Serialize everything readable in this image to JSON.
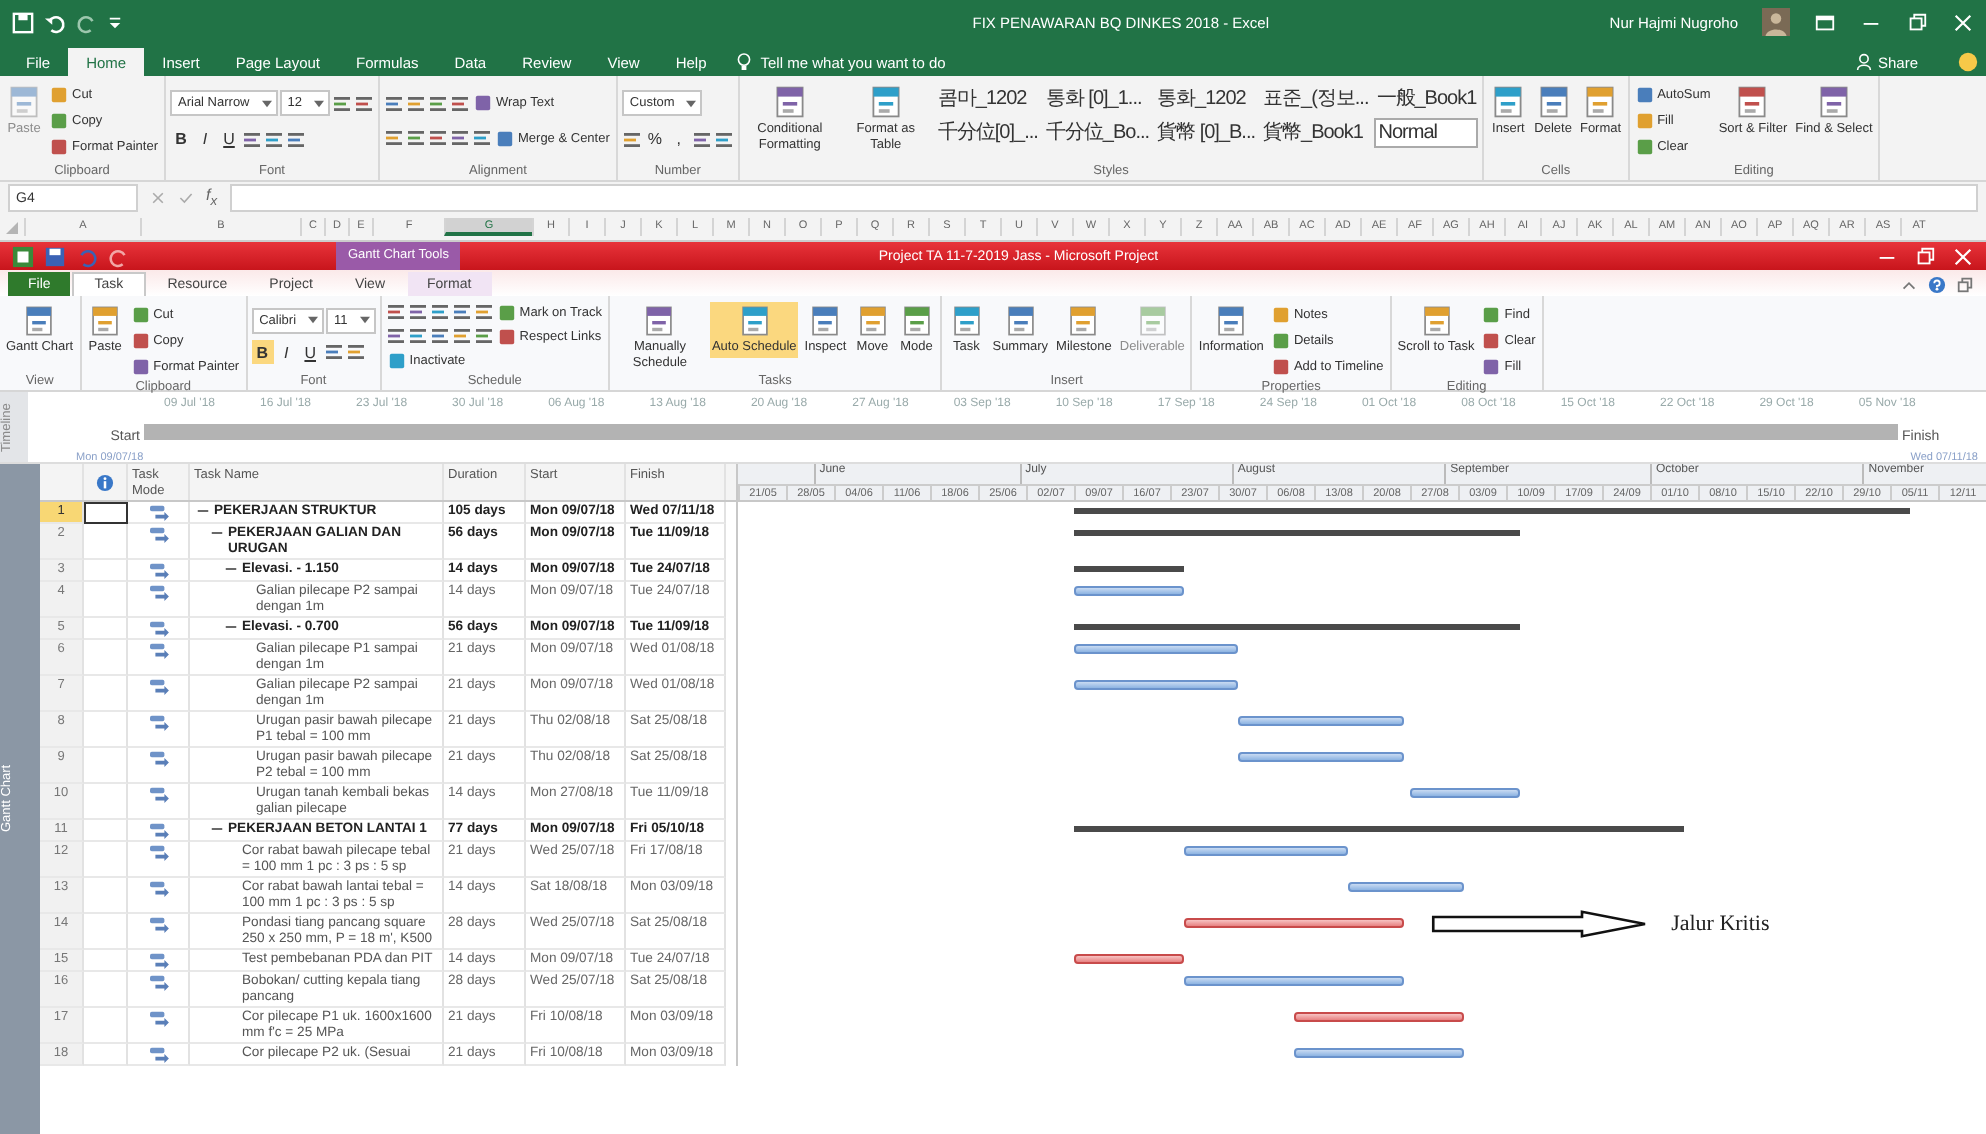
{
  "excel": {
    "title": "FIX PENAWARAN BQ DINKES 2018  -  Excel",
    "user": "Nur Hajmi Nugroho",
    "tabs": [
      {
        "label": "File",
        "selected": false
      },
      {
        "label": "Home",
        "selected": true
      },
      {
        "label": "Insert",
        "selected": false
      },
      {
        "label": "Page Layout",
        "selected": false
      },
      {
        "label": "Formulas",
        "selected": false
      },
      {
        "label": "Data",
        "selected": false
      },
      {
        "label": "Review",
        "selected": false
      },
      {
        "label": "View",
        "selected": false
      },
      {
        "label": "Help",
        "selected": false
      }
    ],
    "tell_me": "Tell me what you want to do",
    "share": "Share",
    "ribbon": [
      {
        "label": "Clipboard",
        "items": [
          {
            "label": "Paste",
            "kind": "large",
            "disabled": true
          },
          {
            "label": "Cut",
            "kind": "small",
            "disabled": false
          },
          {
            "label": "Copy",
            "kind": "small",
            "disabled": false
          },
          {
            "label": "Format Painter",
            "kind": "small",
            "disabled": false
          }
        ]
      },
      {
        "label": "Font",
        "lines": [
          [
            {
              "label": "Arial Narrow",
              "kind": "combo"
            },
            {
              "label": "12",
              "kind": "combo"
            },
            {
              "kind": "icon"
            },
            {
              "kind": "icon"
            }
          ],
          [
            {
              "label": "B",
              "kind": "bold",
              "selected": false
            },
            {
              "label": "I",
              "kind": "italic",
              "selected": false
            },
            {
              "label": "U",
              "kind": "underline",
              "selected": false
            },
            {
              "kind": "icon"
            },
            {
              "kind": "icon"
            },
            {
              "kind": "icon"
            }
          ]
        ]
      },
      {
        "label": "Alignment",
        "lines": [
          [
            {
              "kind": "icon"
            },
            {
              "kind": "icon"
            },
            {
              "kind": "icon"
            },
            {
              "kind": "icon"
            },
            {
              "label": "Wrap Text",
              "kind": "small"
            }
          ],
          [
            {
              "kind": "icon"
            },
            {
              "kind": "icon"
            },
            {
              "kind": "icon"
            },
            {
              "kind": "icon"
            },
            {
              "kind": "icon"
            },
            {
              "label": "Merge & Center",
              "kind": "small"
            }
          ]
        ]
      },
      {
        "label": "Number",
        "lines": [
          [
            {
              "label": "Custom",
              "kind": "combo"
            }
          ],
          [
            {
              "kind": "icon"
            },
            {
              "label": "%",
              "kind": "glyph"
            },
            {
              "label": ",",
              "kind": "glyph"
            },
            {
              "kind": "icon"
            },
            {
              "kind": "icon"
            }
          ]
        ]
      },
      {
        "label": "Styles",
        "items": [
          {
            "label": "Conditional Formatting",
            "kind": "large"
          },
          {
            "label": "Format as Table",
            "kind": "large"
          }
        ],
        "gallery": [
          "콤마_1202",
          "통화 [0]_1...",
          "통화_1202",
          "표준_(정보...",
          "一般_Book1",
          "千分位[0]_...",
          "千分位_Bo...",
          "貨幣 [0]_B...",
          "貨幣_Book1",
          "Normal"
        ]
      },
      {
        "label": "Cells",
        "items": [
          {
            "label": "Insert",
            "kind": "large"
          },
          {
            "label": "Delete",
            "kind": "large"
          },
          {
            "label": "Format",
            "kind": "large"
          }
        ]
      },
      {
        "label": "Editing",
        "items": [
          {
            "label": "AutoSum",
            "kind": "small"
          },
          {
            "label": "Fill",
            "kind": "small"
          },
          {
            "label": "Clear",
            "kind": "small"
          },
          {
            "label": "Sort & Filter",
            "kind": "large"
          },
          {
            "label": "Find & Select",
            "kind": "large"
          }
        ]
      }
    ],
    "name_box": "G4",
    "function_label": "f$_{x}$",
    "columns": [
      {
        "label": "A",
        "selected": false
      },
      {
        "label": "B",
        "selected": false
      },
      {
        "label": "C",
        "selected": false
      },
      {
        "label": "D",
        "selected": false
      },
      {
        "label": "E",
        "selected": false
      },
      {
        "label": "F",
        "selected": false
      },
      {
        "label": "G",
        "selected": true
      },
      {
        "label": "H",
        "selected": false
      },
      {
        "label": "I",
        "selected": false
      },
      {
        "label": "J",
        "selected": false
      },
      {
        "label": "K",
        "selected": false
      },
      {
        "label": "L",
        "selected": false
      },
      {
        "label": "M",
        "selected": false
      },
      {
        "label": "N",
        "selected": false
      },
      {
        "label": "O",
        "selected": false
      },
      {
        "label": "P",
        "selected": false
      },
      {
        "label": "Q",
        "selected": false
      },
      {
        "label": "R",
        "selected": false
      },
      {
        "label": "S",
        "selected": false
      },
      {
        "label": "T",
        "selected": false
      },
      {
        "label": "U",
        "selected": false
      },
      {
        "label": "V",
        "selected": false
      },
      {
        "label": "W",
        "selected": false
      },
      {
        "label": "X",
        "selected": false
      },
      {
        "label": "Y",
        "selected": false
      },
      {
        "label": "Z",
        "selected": false
      },
      {
        "label": "AA",
        "selected": false
      },
      {
        "label": "AB",
        "selected": false
      },
      {
        "label": "AC",
        "selected": false
      },
      {
        "label": "AD",
        "selected": false
      },
      {
        "label": "AE",
        "selected": false
      },
      {
        "label": "AF",
        "selected": false
      },
      {
        "label": "AG",
        "selected": false
      },
      {
        "label": "AH",
        "selected": false
      },
      {
        "label": "AI",
        "selected": false
      },
      {
        "label": "AJ",
        "selected": false
      },
      {
        "label": "AK",
        "selected": false
      },
      {
        "label": "AL",
        "selected": false
      },
      {
        "label": "AM",
        "selected": false
      },
      {
        "label": "AN",
        "selected": false
      },
      {
        "label": "AO",
        "selected": false
      },
      {
        "label": "AP",
        "selected": false
      },
      {
        "label": "AQ",
        "selected": false
      },
      {
        "label": "AR",
        "selected": false
      },
      {
        "label": "AS",
        "selected": false
      },
      {
        "label": "AT",
        "selected": false
      }
    ]
  },
  "project": {
    "context_label": "Gantt Chart Tools",
    "title": "Project TA 11-7-2019 Jass  -  Microsoft Project",
    "tabs": [
      {
        "label": "File",
        "selected": false
      },
      {
        "label": "Task",
        "selected": true
      },
      {
        "label": "Resource",
        "selected": false
      },
      {
        "label": "Project",
        "selected": false
      },
      {
        "label": "View",
        "selected": false
      },
      {
        "label": "Format",
        "selected": false
      }
    ],
    "ribbon": [
      {
        "label": "View",
        "items": [
          {
            "label": "Gantt Chart",
            "kind": "large"
          }
        ]
      },
      {
        "label": "Clipboard",
        "items": [
          {
            "label": "Paste",
            "kind": "large"
          },
          {
            "label": "Cut",
            "kind": "small"
          },
          {
            "label": "Copy",
            "kind": "small"
          },
          {
            "label": "Format Painter",
            "kind": "small"
          }
        ]
      },
      {
        "label": "Font",
        "lines": [
          [
            {
              "label": "Calibri",
              "kind": "combo"
            },
            {
              "label": "11",
              "kind": "combo"
            }
          ],
          [
            {
              "label": "B",
              "kind": "bold",
              "selected": true
            },
            {
              "label": "I",
              "kind": "italic",
              "selected": false
            },
            {
              "label": "U",
              "kind": "underline",
              "selected": false
            },
            {
              "kind": "icon"
            },
            {
              "kind": "icon"
            }
          ]
        ]
      },
      {
        "label": "Schedule",
        "lines": [
          [
            {
              "kind": "icon"
            },
            {
              "kind": "icon"
            },
            {
              "kind": "icon"
            },
            {
              "kind": "icon"
            },
            {
              "kind": "icon"
            },
            {
              "label": "Mark on Track",
              "kind": "small"
            }
          ],
          [
            {
              "kind": "icon"
            },
            {
              "kind": "icon"
            },
            {
              "kind": "icon"
            },
            {
              "kind": "icon"
            },
            {
              "kind": "icon"
            },
            {
              "label": "Respect Links",
              "kind": "small"
            }
          ],
          [
            {
              "label": "Inactivate",
              "kind": "small"
            }
          ]
        ]
      },
      {
        "label": "Tasks",
        "items": [
          {
            "label": "Manually Schedule",
            "kind": "large",
            "selected": false
          },
          {
            "label": "Auto Schedule",
            "kind": "large",
            "selected": true
          },
          {
            "label": "Inspect",
            "kind": "large",
            "selected": false
          },
          {
            "label": "Move",
            "kind": "large",
            "selected": false
          },
          {
            "label": "Mode",
            "kind": "large",
            "selected": false
          }
        ]
      },
      {
        "label": "Insert",
        "items": [
          {
            "label": "Task",
            "kind": "large",
            "disabled": false
          },
          {
            "label": "Summary",
            "kind": "large",
            "disabled": false
          },
          {
            "label": "Milestone",
            "kind": "large",
            "disabled": false
          },
          {
            "label": "Deliverable",
            "kind": "large",
            "disabled": true
          }
        ]
      },
      {
        "label": "Properties",
        "items": [
          {
            "label": "Information",
            "kind": "large"
          },
          {
            "label": "Notes",
            "kind": "small"
          },
          {
            "label": "Details",
            "kind": "small"
          },
          {
            "label": "Add to Timeline",
            "kind": "small"
          }
        ]
      },
      {
        "label": "Editing",
        "items": [
          {
            "label": "Scroll to Task",
            "kind": "large"
          },
          {
            "label": "Find",
            "kind": "small"
          },
          {
            "label": "Clear",
            "kind": "small"
          },
          {
            "label": "Fill",
            "kind": "small"
          }
        ]
      }
    ],
    "timeline": {
      "label": "Timeline",
      "dates": [
        "09 Jul '18",
        "16 Jul '18",
        "23 Jul '18",
        "30 Jul '18",
        "06 Aug '18",
        "13 Aug '18",
        "20 Aug '18",
        "27 Aug '18",
        "03 Sep '18",
        "10 Sep '18",
        "17 Sep '18",
        "24 Sep '18",
        "01 Oct '18",
        "08 Oct '18",
        "15 Oct '18",
        "22 Oct '18",
        "29 Oct '18",
        "05 Nov '18"
      ],
      "start_label": "Start",
      "start": "Mon 09/07/18",
      "finish_label": "Finish",
      "finish": "Wed 07/11/18"
    },
    "gantt": {
      "side_label": "Gantt Chart",
      "columns": [
        "Task Mode",
        "Task Name",
        "Duration",
        "Start",
        "Finish"
      ],
      "months": [
        "June",
        "July",
        "August",
        "September",
        "October",
        "November"
      ],
      "weeks": [
        "21/05",
        "28/05",
        "04/06",
        "11/06",
        "18/06",
        "25/06",
        "02/07",
        "09/07",
        "16/07",
        "23/07",
        "30/07",
        "06/08",
        "13/08",
        "20/08",
        "27/08",
        "03/09",
        "10/09",
        "17/09",
        "24/09",
        "01/10",
        "08/10",
        "15/10",
        "22/10",
        "29/10",
        "05/11",
        "12/11"
      ],
      "tasks": [
        {
          "row": "1",
          "name": "PEKERJAAN STRUKTUR",
          "duration": "105 days",
          "start": "Mon 09/07/18",
          "finish": "Wed 07/11/18",
          "selected": true,
          "critical": false,
          "expanded": true,
          "children": [
            {
              "row": "2",
              "name": "PEKERJAAN GALIAN DAN URUGAN",
              "duration": "56 days",
              "start": "Mon 09/07/18",
              "finish": "Tue 11/09/18",
              "selected": false,
              "critical": false,
              "expanded": true,
              "children": [
                {
                  "row": "3",
                  "name": "Elevasi. - 1.150",
                  "duration": "14 days",
                  "start": "Mon 09/07/18",
                  "finish": "Tue 24/07/18",
                  "selected": false,
                  "critical": false,
                  "expanded": true,
                  "children": [
                    {
                      "row": "4",
                      "name": "Galian pilecape P2 sampai dengan 1m",
                      "duration": "14 days",
                      "start": "Mon 09/07/18",
                      "finish": "Tue 24/07/18",
                      "selected": false,
                      "critical": false
                    }
                  ]
                },
                {
                  "row": "5",
                  "name": "Elevasi. - 0.700",
                  "duration": "56 days",
                  "start": "Mon 09/07/18",
                  "finish": "Tue 11/09/18",
                  "selected": false,
                  "critical": false,
                  "expanded": true,
                  "children": [
                    {
                      "row": "6",
                      "name": "Galian pilecape P1 sampai dengan 1m",
                      "duration": "21 days",
                      "start": "Mon 09/07/18",
                      "finish": "Wed 01/08/18",
                      "selected": false,
                      "critical": false
                    },
                    {
                      "row": "7",
                      "name": "Galian pilecape P2 sampai dengan 1m",
                      "duration": "21 days",
                      "start": "Mon 09/07/18",
                      "finish": "Wed 01/08/18",
                      "selected": false,
                      "critical": false
                    },
                    {
                      "row": "8",
                      "name": "Urugan pasir bawah pilecape P1 tebal = 100 mm",
                      "duration": "21 days",
                      "start": "Thu 02/08/18",
                      "finish": "Sat 25/08/18",
                      "selected": false,
                      "critical": false
                    },
                    {
                      "row": "9",
                      "name": "Urugan pasir bawah pilecape P2 tebal = 100 mm",
                      "duration": "21 days",
                      "start": "Thu 02/08/18",
                      "finish": "Sat 25/08/18",
                      "selected": false,
                      "critical": false
                    },
                    {
                      "row": "10",
                      "name": "Urugan tanah kembali bekas galian pilecape",
                      "duration": "14 days",
                      "start": "Mon 27/08/18",
                      "finish": "Tue 11/09/18",
                      "selected": false,
                      "critical": false
                    }
                  ]
                }
              ]
            },
            {
              "row": "11",
              "name": "PEKERJAAN BETON LANTAI 1",
              "duration": "77 days",
              "start": "Mon 09/07/18",
              "finish": "Fri 05/10/18",
              "selected": false,
              "critical": false,
              "expanded": true,
              "children": [
                {
                  "row": "12",
                  "name": "Cor rabat bawah pilecape tebal = 100 mm 1 pc : 3 ps : 5 sp",
                  "duration": "21 days",
                  "start": "Wed 25/07/18",
                  "finish": "Fri 17/08/18",
                  "selected": false,
                  "critical": false
                },
                {
                  "row": "13",
                  "name": "Cor rabat bawah lantai tebal = 100 mm 1 pc : 3 ps : 5 sp",
                  "duration": "14 days",
                  "start": "Sat 18/08/18",
                  "finish": "Mon 03/09/18",
                  "selected": false,
                  "critical": false
                },
                {
                  "row": "14",
                  "name": "Pondasi tiang pancang square 250 x 250 mm, P = 18 m', K500",
                  "duration": "28 days",
                  "start": "Wed 25/07/18",
                  "finish": "Sat 25/08/18",
                  "selected": false,
                  "critical": true,
                  "annotation": "Jalur Kritis"
                },
                {
                  "row": "15",
                  "name": "Test pembebanan PDA dan PIT",
                  "duration": "14 days",
                  "start": "Mon 09/07/18",
                  "finish": "Tue 24/07/18",
                  "selected": false,
                  "critical": true
                },
                {
                  "row": "16",
                  "name": "Bobokan/ cutting kepala tiang pancang",
                  "duration": "28 days",
                  "start": "Wed 25/07/18",
                  "finish": "Sat 25/08/18",
                  "selected": false,
                  "critical": false
                },
                {
                  "row": "17",
                  "name": "Cor pilecape P1 uk. 1600x1600 mm  f'c = 25 MPa",
                  "duration": "21 days",
                  "start": "Fri 10/08/18",
                  "finish": "Mon 03/09/18",
                  "selected": false,
                  "critical": true
                },
                {
                  "row": "18",
                  "name": "Cor pilecape P2 uk. (Sesuai",
                  "duration": "21 days",
                  "start": "Fri 10/08/18",
                  "finish": "Mon 03/09/18",
                  "selected": false,
                  "critical": false
                }
              ]
            }
          ]
        }
      ]
    }
  }
}
